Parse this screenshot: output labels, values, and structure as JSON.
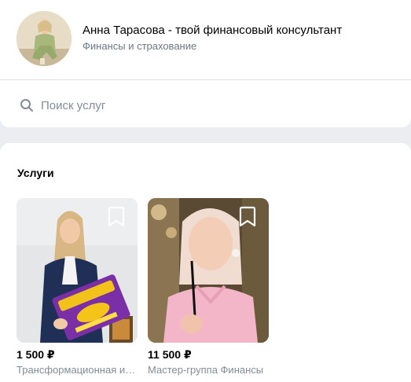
{
  "header": {
    "title": "Анна Тарасова - твой финансовый консультант",
    "subtitle": "Финансы и страхование",
    "avatar_icon": "profile-photo"
  },
  "search": {
    "placeholder": "Поиск услуг",
    "value": "",
    "icon": "search-icon"
  },
  "services": {
    "heading": "Услуги",
    "items": [
      {
        "price": "1 500 ₽",
        "name": "Трансформационная игра",
        "bookmark_icon": "bookmark-icon"
      },
      {
        "price": "11 500 ₽",
        "name": "Мастер-группа Финансы",
        "bookmark_icon": "bookmark-icon"
      }
    ]
  },
  "colors": {
    "background": "#ebedf0",
    "card": "#ffffff",
    "secondary_text": "#818c99",
    "subtitle_text": "#6d7885"
  }
}
